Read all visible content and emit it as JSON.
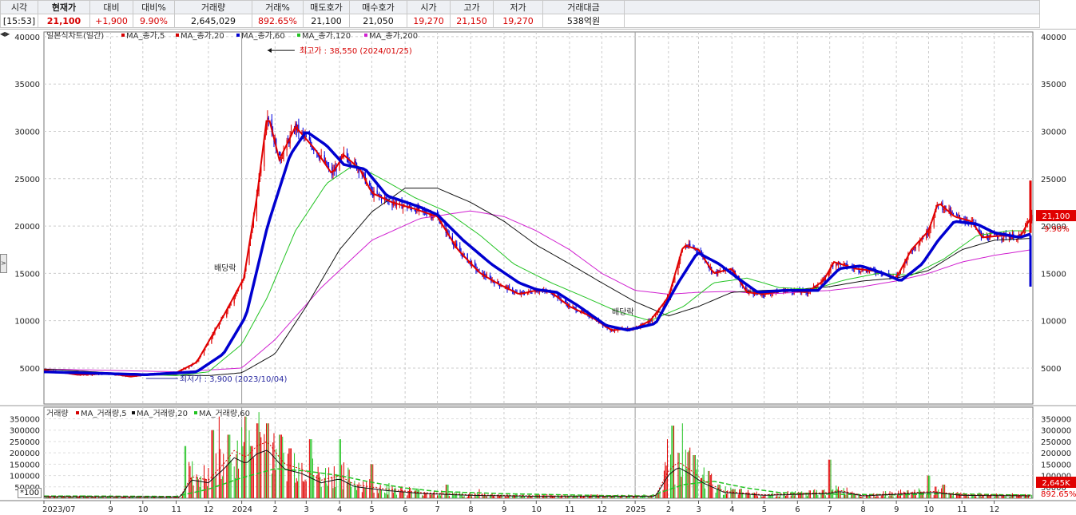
{
  "header": {
    "labels": [
      "시각",
      "현재가",
      "대비",
      "대비%",
      "거래량",
      "거래%",
      "매도호가",
      "매수호가",
      "시가",
      "고가",
      "저가",
      "거래대금"
    ],
    "values": [
      "[15:53]",
      "21,100",
      "+1,900",
      "9.90%",
      "2,645,029",
      "892.65%",
      "21,100",
      "21,050",
      "19,270",
      "21,150",
      "19,270",
      "538억원"
    ],
    "colors": [
      "#111111",
      "#d60000",
      "#d60000",
      "#d60000",
      "#111111",
      "#d60000",
      "#111111",
      "#111111",
      "#d60000",
      "#d60000",
      "#d60000",
      "#111111"
    ]
  },
  "chart_data": [
    {
      "type": "candlestick",
      "title": "일본식차트(일간)",
      "legend": [
        {
          "name": "MA_종가,5",
          "color": "#d60000"
        },
        {
          "name": "MA_종가,20",
          "color": "#d60000"
        },
        {
          "name": "MA_종가,60",
          "color": "#0000d0"
        },
        {
          "name": "MA_종가,120",
          "color": "#22c322"
        },
        {
          "name": "MA_종가,200",
          "color": "#d020d0"
        }
      ],
      "y_ticks": [
        5000,
        10000,
        15000,
        20000,
        25000,
        30000,
        35000,
        40000
      ],
      "y_range": [
        1200,
        40500
      ],
      "x_ticks": [
        "2023/07",
        "9",
        "10",
        "11",
        "12",
        "2024",
        "2",
        "3",
        "4",
        "5",
        "6",
        "7",
        "8",
        "9",
        "10",
        "11",
        "12",
        "2025",
        "2",
        "3",
        "4",
        "5",
        "6",
        "7",
        "8",
        "9",
        "10",
        "11",
        "12"
      ],
      "price_path": [
        [
          "2023-07-01",
          4800
        ],
        [
          "2023-08-01",
          4300
        ],
        [
          "2023-09-01",
          4400
        ],
        [
          "2023-09-20",
          4100
        ],
        [
          "2023-10-04",
          4300
        ],
        [
          "2023-11-01",
          4500
        ],
        [
          "2023-11-20",
          5600
        ],
        [
          "2023-12-15",
          10500
        ],
        [
          "2024-01-03",
          14500
        ],
        [
          "2024-01-15",
          23000
        ],
        [
          "2024-01-25",
          32000
        ],
        [
          "2024-02-05",
          27000
        ],
        [
          "2024-02-20",
          30500
        ],
        [
          "2024-03-10",
          28000
        ],
        [
          "2024-03-25",
          25500
        ],
        [
          "2024-04-05",
          27500
        ],
        [
          "2024-04-20",
          26000
        ],
        [
          "2024-05-01",
          23500
        ],
        [
          "2024-05-20",
          22500
        ],
        [
          "2024-06-10",
          21800
        ],
        [
          "2024-07-01",
          21000
        ],
        [
          "2024-07-20",
          17500
        ],
        [
          "2024-08-10",
          15000
        ],
        [
          "2024-08-25",
          14000
        ],
        [
          "2024-09-15",
          12800
        ],
        [
          "2024-10-01",
          13200
        ],
        [
          "2024-10-15",
          13000
        ],
        [
          "2024-11-01",
          11500
        ],
        [
          "2024-11-20",
          10500
        ],
        [
          "2024-12-10",
          9000
        ],
        [
          "2025-01-01",
          9200
        ],
        [
          "2025-01-15",
          10000
        ],
        [
          "2025-02-01",
          12500
        ],
        [
          "2025-02-15",
          18000
        ],
        [
          "2025-03-01",
          17500
        ],
        [
          "2025-03-15",
          15000
        ],
        [
          "2025-04-01",
          15500
        ],
        [
          "2025-04-15",
          13000
        ],
        [
          "2025-05-01",
          12800
        ],
        [
          "2025-05-20",
          13200
        ],
        [
          "2025-06-10",
          13000
        ],
        [
          "2025-06-25",
          14200
        ],
        [
          "2025-07-05",
          16200
        ],
        [
          "2025-07-25",
          15500
        ],
        [
          "2025-08-15",
          15200
        ],
        [
          "2025-09-01",
          14500
        ],
        [
          "2025-09-15",
          17500
        ],
        [
          "2025-10-01",
          19500
        ],
        [
          "2025-10-10",
          22500
        ],
        [
          "2025-10-25",
          21000
        ],
        [
          "2025-11-10",
          20500
        ],
        [
          "2025-11-20",
          18800
        ],
        [
          "2025-12-10",
          19000
        ],
        [
          "2025-12-25",
          18800
        ],
        [
          "2026-01-05",
          21100
        ]
      ],
      "ma60_path": [
        [
          "2023-07-01",
          4600
        ],
        [
          "2023-10-04",
          4300
        ],
        [
          "2023-11-20",
          4600
        ],
        [
          "2023-12-15",
          6500
        ],
        [
          "2024-01-05",
          10500
        ],
        [
          "2024-01-25",
          20000
        ],
        [
          "2024-02-15",
          27500
        ],
        [
          "2024-03-01",
          30000
        ],
        [
          "2024-03-20",
          28500
        ],
        [
          "2024-04-05",
          26500
        ],
        [
          "2024-04-25",
          26000
        ],
        [
          "2024-05-15",
          23200
        ],
        [
          "2024-06-15",
          22000
        ],
        [
          "2024-07-01",
          21200
        ],
        [
          "2024-07-25",
          18500
        ],
        [
          "2024-08-20",
          16000
        ],
        [
          "2024-09-15",
          14000
        ],
        [
          "2024-10-01",
          13300
        ],
        [
          "2024-10-20",
          13000
        ],
        [
          "2024-11-10",
          11500
        ],
        [
          "2024-12-05",
          9500
        ],
        [
          "2024-12-25",
          9000
        ],
        [
          "2025-01-20",
          9700
        ],
        [
          "2025-02-10",
          14000
        ],
        [
          "2025-02-28",
          17200
        ],
        [
          "2025-03-20",
          16000
        ],
        [
          "2025-04-10",
          14200
        ],
        [
          "2025-04-25",
          13000
        ],
        [
          "2025-05-20",
          13200
        ],
        [
          "2025-06-20",
          13200
        ],
        [
          "2025-07-10",
          15500
        ],
        [
          "2025-07-30",
          15800
        ],
        [
          "2025-08-20",
          15000
        ],
        [
          "2025-09-05",
          14200
        ],
        [
          "2025-09-25",
          16000
        ],
        [
          "2025-10-10",
          18500
        ],
        [
          "2025-10-25",
          20500
        ],
        [
          "2025-11-15",
          20200
        ],
        [
          "2025-12-01",
          19300
        ],
        [
          "2025-12-25",
          18800
        ],
        [
          "2026-01-05",
          19200
        ]
      ],
      "ma120_path": [
        [
          "2023-07-01",
          4700
        ],
        [
          "2023-11-01",
          4200
        ],
        [
          "2023-12-01",
          4600
        ],
        [
          "2024-01-01",
          7500
        ],
        [
          "2024-01-25",
          12500
        ],
        [
          "2024-02-20",
          19500
        ],
        [
          "2024-03-20",
          24500
        ],
        [
          "2024-04-15",
          26500
        ],
        [
          "2024-05-10",
          25000
        ],
        [
          "2024-06-10",
          23000
        ],
        [
          "2024-07-10",
          21500
        ],
        [
          "2024-08-10",
          19000
        ],
        [
          "2024-09-10",
          16000
        ],
        [
          "2024-10-15",
          14000
        ],
        [
          "2024-11-15",
          12500
        ],
        [
          "2024-12-15",
          11000
        ],
        [
          "2025-01-15",
          10000
        ],
        [
          "2025-02-15",
          11500
        ],
        [
          "2025-03-15",
          14000
        ],
        [
          "2025-04-15",
          14500
        ],
        [
          "2025-05-15",
          13500
        ],
        [
          "2025-06-15",
          13300
        ],
        [
          "2025-07-15",
          14300
        ],
        [
          "2025-08-15",
          15000
        ],
        [
          "2025-09-15",
          14800
        ],
        [
          "2025-10-15",
          16500
        ],
        [
          "2025-11-15",
          19000
        ],
        [
          "2025-12-15",
          19500
        ],
        [
          "2026-01-05",
          19500
        ]
      ],
      "ma200_path": [
        [
          "2023-07-01",
          4900
        ],
        [
          "2023-10-01",
          4300
        ],
        [
          "2023-12-01",
          4200
        ],
        [
          "2024-01-01",
          4500
        ],
        [
          "2024-02-01",
          6500
        ],
        [
          "2024-03-01",
          11500
        ],
        [
          "2024-04-01",
          17500
        ],
        [
          "2024-05-01",
          21500
        ],
        [
          "2024-06-01",
          24000
        ],
        [
          "2024-07-01",
          24000
        ],
        [
          "2024-08-01",
          22500
        ],
        [
          "2024-09-01",
          20500
        ],
        [
          "2024-10-01",
          18000
        ],
        [
          "2024-11-01",
          16000
        ],
        [
          "2024-12-01",
          14000
        ],
        [
          "2025-01-01",
          12000
        ],
        [
          "2025-02-01",
          10500
        ],
        [
          "2025-03-01",
          11500
        ],
        [
          "2025-04-01",
          13000
        ],
        [
          "2025-05-01",
          13200
        ],
        [
          "2025-06-01",
          13300
        ],
        [
          "2025-07-01",
          13600
        ],
        [
          "2025-08-01",
          14200
        ],
        [
          "2025-09-01",
          14500
        ],
        [
          "2025-10-01",
          15300
        ],
        [
          "2025-11-01",
          17500
        ],
        [
          "2025-12-01",
          18500
        ],
        [
          "2026-01-05",
          18700
        ]
      ],
      "ma_long_path": [
        [
          "2023-07-01",
          4900
        ],
        [
          "2023-11-01",
          4600
        ],
        [
          "2024-01-01",
          5000
        ],
        [
          "2024-02-01",
          8000
        ],
        [
          "2024-03-15",
          13500
        ],
        [
          "2024-05-01",
          18500
        ],
        [
          "2024-06-15",
          20800
        ],
        [
          "2024-08-01",
          21600
        ],
        [
          "2024-09-01",
          21000
        ],
        [
          "2024-10-01",
          19500
        ],
        [
          "2024-11-01",
          17500
        ],
        [
          "2024-12-01",
          15000
        ],
        [
          "2025-01-01",
          13200
        ],
        [
          "2025-02-01",
          12800
        ],
        [
          "2025-03-01",
          13000
        ],
        [
          "2025-04-01",
          13100
        ],
        [
          "2025-05-01",
          12800
        ],
        [
          "2025-06-01",
          13000
        ],
        [
          "2025-07-01",
          13200
        ],
        [
          "2025-08-01",
          13600
        ],
        [
          "2025-09-01",
          14200
        ],
        [
          "2025-10-01",
          15000
        ],
        [
          "2025-11-01",
          16200
        ],
        [
          "2025-12-01",
          16900
        ],
        [
          "2026-01-05",
          17500
        ]
      ],
      "annotations": [
        {
          "text": "최고가 : 38,550 (2024/01/25)",
          "color": "#d60000"
        },
        {
          "text": "최저가 : 3,900 (2023/10/04)",
          "color": "#2828a0"
        },
        {
          "text": "배당락",
          "color": "#111111"
        },
        {
          "text": "배당락",
          "color": "#111111"
        }
      ],
      "current_price": {
        "label": "21,100",
        "pct": "9.90%"
      }
    },
    {
      "type": "bar",
      "title": "거래량",
      "legend": [
        {
          "name": "MA_거래량,5",
          "color": "#d60000"
        },
        {
          "name": "MA_거래량,20",
          "color": "#111111"
        },
        {
          "name": "MA_거래량,60",
          "color": "#22c322"
        }
      ],
      "y_ticks": [
        50000,
        100000,
        150000,
        200000,
        250000,
        300000,
        350000
      ],
      "y_range": [
        0,
        380000
      ],
      "unit": "*100",
      "spikes": [
        [
          "2023-11-10",
          230000
        ],
        [
          "2023-11-12",
          160000
        ],
        [
          "2023-12-05",
          300000
        ],
        [
          "2023-12-10",
          360000
        ],
        [
          "2023-12-20",
          280000
        ],
        [
          "2024-01-05",
          360000
        ],
        [
          "2024-01-10",
          230000
        ],
        [
          "2024-01-15",
          330000
        ],
        [
          "2024-01-25",
          330000
        ],
        [
          "2024-02-05",
          280000
        ],
        [
          "2024-02-15",
          220000
        ],
        [
          "2024-03-05",
          260000
        ],
        [
          "2024-04-01",
          260000
        ],
        [
          "2024-05-01",
          150000
        ],
        [
          "2024-07-10",
          60000
        ],
        [
          "2024-08-10",
          40000
        ],
        [
          "2025-02-01",
          260000
        ],
        [
          "2025-02-05",
          320000
        ],
        [
          "2025-02-10",
          200000
        ],
        [
          "2025-02-15",
          330000
        ],
        [
          "2025-02-25",
          190000
        ],
        [
          "2025-03-10",
          120000
        ],
        [
          "2025-03-20",
          60000
        ],
        [
          "2025-07-01",
          170000
        ],
        [
          "2025-10-01",
          100000
        ],
        [
          "2025-10-15",
          60000
        ]
      ],
      "ma20_path": [
        [
          "2023-07-01",
          8000
        ],
        [
          "2023-11-05",
          6000
        ],
        [
          "2023-11-15",
          95000
        ],
        [
          "2023-12-01",
          80000
        ],
        [
          "2023-12-15",
          150000
        ],
        [
          "2023-12-25",
          210000
        ],
        [
          "2024-01-05",
          180000
        ],
        [
          "2024-01-15",
          230000
        ],
        [
          "2024-01-25",
          250000
        ],
        [
          "2024-02-10",
          150000
        ],
        [
          "2024-02-25",
          130000
        ],
        [
          "2024-03-15",
          80000
        ],
        [
          "2024-04-01",
          100000
        ],
        [
          "2024-04-15",
          60000
        ],
        [
          "2024-05-15",
          40000
        ],
        [
          "2024-06-15",
          25000
        ],
        [
          "2024-08-01",
          15000
        ],
        [
          "2024-10-01",
          10000
        ],
        [
          "2025-01-20",
          10000
        ],
        [
          "2025-02-01",
          120000
        ],
        [
          "2025-02-10",
          160000
        ],
        [
          "2025-02-20",
          130000
        ],
        [
          "2025-03-05",
          80000
        ],
        [
          "2025-03-25",
          30000
        ],
        [
          "2025-05-01",
          15000
        ],
        [
          "2025-07-01",
          25000
        ],
        [
          "2025-07-10",
          35000
        ],
        [
          "2025-08-01",
          12000
        ],
        [
          "2025-10-05",
          30000
        ],
        [
          "2025-11-01",
          15000
        ],
        [
          "2026-01-05",
          12000
        ]
      ],
      "ma60_path": [
        [
          "2023-07-01",
          10000
        ],
        [
          "2023-11-01",
          8000
        ],
        [
          "2023-12-01",
          40000
        ],
        [
          "2024-01-01",
          90000
        ],
        [
          "2024-02-01",
          130000
        ],
        [
          "2024-03-01",
          120000
        ],
        [
          "2024-04-01",
          100000
        ],
        [
          "2024-05-01",
          70000
        ],
        [
          "2024-06-01",
          45000
        ],
        [
          "2024-07-01",
          30000
        ],
        [
          "2024-09-01",
          20000
        ],
        [
          "2024-12-01",
          12000
        ],
        [
          "2025-01-15",
          10000
        ],
        [
          "2025-02-15",
          60000
        ],
        [
          "2025-03-15",
          75000
        ],
        [
          "2025-04-15",
          45000
        ],
        [
          "2025-05-15",
          25000
        ],
        [
          "2025-07-01",
          18000
        ],
        [
          "2025-09-01",
          15000
        ],
        [
          "2025-10-15",
          20000
        ],
        [
          "2025-12-01",
          16000
        ],
        [
          "2026-01-05",
          14000
        ]
      ],
      "current_volume": {
        "label": "2,645K",
        "pct": "892.65%"
      }
    }
  ]
}
